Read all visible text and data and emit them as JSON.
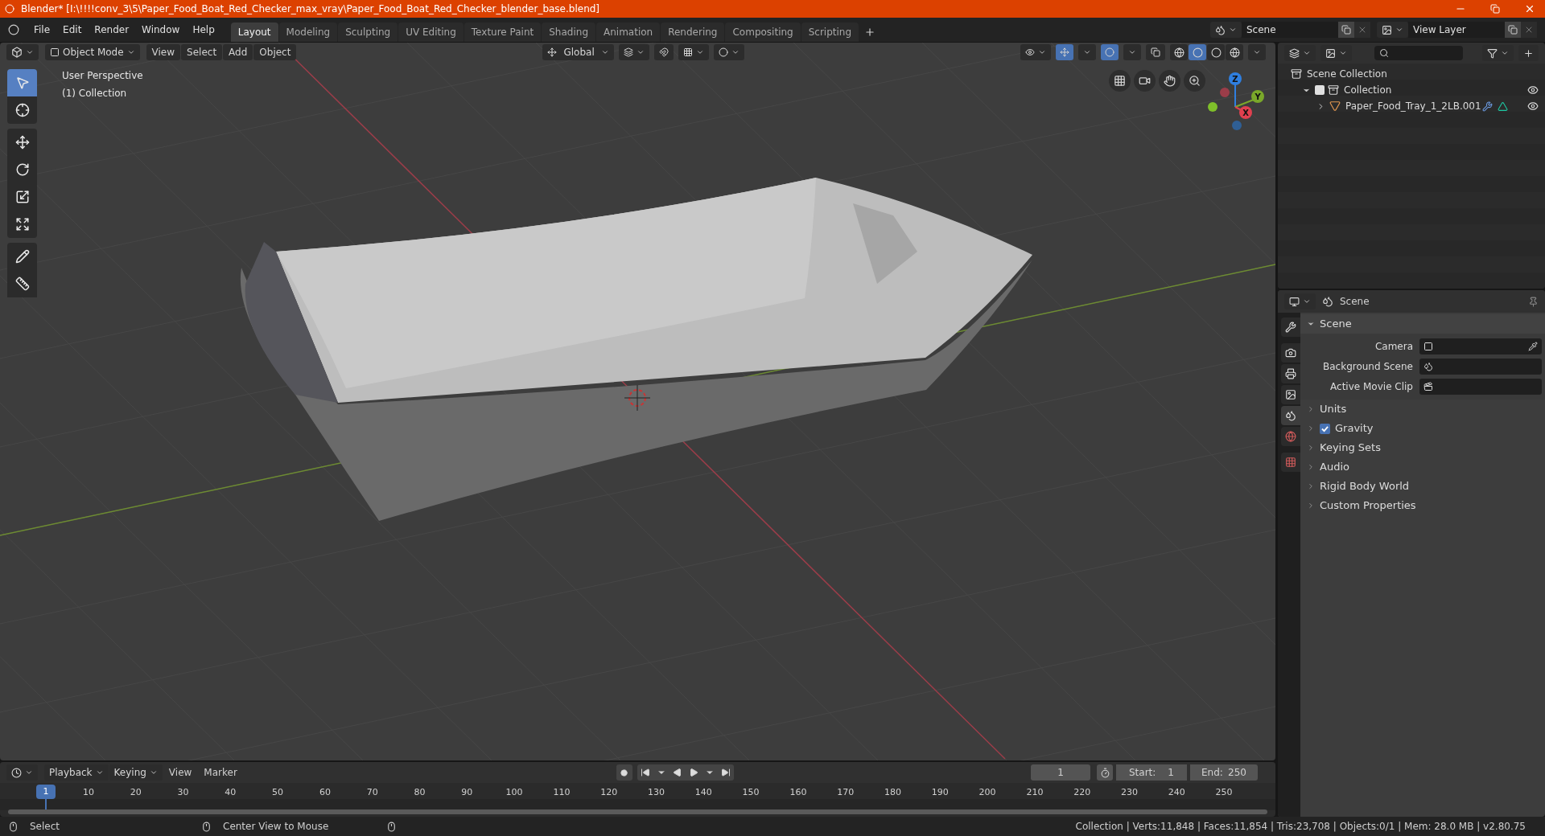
{
  "title_bar": {
    "title": "Blender* [I:\\!!!!conv_3\\5\\Paper_Food_Boat_Red_Checker_max_vray\\Paper_Food_Boat_Red_Checker_blender_base.blend]"
  },
  "menu": [
    "File",
    "Edit",
    "Render",
    "Window",
    "Help"
  ],
  "workspaces": [
    {
      "label": "Layout",
      "selected": true
    },
    {
      "label": "Modeling",
      "selected": false
    },
    {
      "label": "Sculpting",
      "selected": false
    },
    {
      "label": "UV Editing",
      "selected": false
    },
    {
      "label": "Texture Paint",
      "selected": false
    },
    {
      "label": "Shading",
      "selected": false
    },
    {
      "label": "Animation",
      "selected": false
    },
    {
      "label": "Rendering",
      "selected": false
    },
    {
      "label": "Compositing",
      "selected": false
    },
    {
      "label": "Scripting",
      "selected": false
    }
  ],
  "scene": {
    "value": "Scene"
  },
  "view_layer": {
    "value": "View Layer"
  },
  "viewport_header": {
    "mode": "Object Mode",
    "menus": [
      "View",
      "Select",
      "Add",
      "Object"
    ],
    "orientation": "Global",
    "gizmos_on": true,
    "overlays_on": true,
    "shading": [
      {
        "kind": "wireframe",
        "selected": false
      },
      {
        "kind": "solid",
        "selected": true
      },
      {
        "kind": "material",
        "selected": false
      },
      {
        "kind": "rendered",
        "selected": false
      }
    ]
  },
  "viewport": {
    "view_name": "User Perspective",
    "collection_label": "(1) Collection",
    "axes": [
      {
        "label": "Z",
        "color": "#2f7fe0"
      },
      {
        "label": "Y",
        "color": "#7aa82a"
      },
      {
        "label": "X",
        "color": "#e0404f"
      }
    ]
  },
  "tools": [
    {
      "kind": "select",
      "selected": true
    },
    {
      "kind": "cursor",
      "selected": false
    },
    {
      "kind": "move",
      "selected": false
    },
    {
      "kind": "rotate",
      "selected": false
    },
    {
      "kind": "scale",
      "selected": false
    },
    {
      "kind": "transform",
      "selected": false
    },
    {
      "kind": "annotate",
      "selected": false
    },
    {
      "kind": "measure",
      "selected": false
    }
  ],
  "outliner": {
    "tree": [
      {
        "label": "Scene Collection",
        "kind": "scene_collection",
        "children": [
          {
            "label": "Collection",
            "kind": "collection",
            "checked": true,
            "expanded": true,
            "visible": true,
            "children": [
              {
                "label": "Paper_Food_Tray_1_2LB.001",
                "kind": "mesh",
                "expanded": false,
                "visible": true
              }
            ]
          }
        ]
      }
    ]
  },
  "properties": {
    "context": "Scene",
    "tabs": [
      {
        "kind": "tool",
        "selected": false
      },
      {
        "kind": "render",
        "selected": false
      },
      {
        "kind": "output",
        "selected": false
      },
      {
        "kind": "view_layer",
        "selected": false
      },
      {
        "kind": "scene",
        "selected": true
      },
      {
        "kind": "world",
        "selected": false
      },
      {
        "kind": "texture",
        "selected": false
      }
    ],
    "section": {
      "label": "Scene",
      "expanded": true,
      "fields": [
        {
          "label": "Camera",
          "kind": "camera"
        },
        {
          "label": "Background Scene",
          "kind": "scene"
        },
        {
          "label": "Active Movie Clip",
          "kind": "clip"
        }
      ]
    },
    "panels": [
      {
        "label": "Units",
        "kind": "plain"
      },
      {
        "label": "Gravity",
        "kind": "checkbox",
        "checked": true
      },
      {
        "label": "Keying Sets",
        "kind": "plain"
      },
      {
        "label": "Audio",
        "kind": "plain"
      },
      {
        "label": "Rigid Body World",
        "kind": "plain"
      },
      {
        "label": "Custom Properties",
        "kind": "plain"
      }
    ]
  },
  "timeline": {
    "menus": [
      {
        "label": "Playback",
        "dropdown": true
      },
      {
        "label": "Keying",
        "dropdown": true
      },
      {
        "label": "View",
        "dropdown": false
      },
      {
        "label": "Marker",
        "dropdown": false
      }
    ],
    "current_frame": "1",
    "start_label": "Start:",
    "start": "1",
    "end_label": "End:",
    "end": "250",
    "playhead": "1",
    "ruler": [
      "10",
      "20",
      "30",
      "40",
      "50",
      "60",
      "70",
      "80",
      "90",
      "100",
      "110",
      "120",
      "130",
      "140",
      "150",
      "160",
      "170",
      "180",
      "190",
      "200",
      "210",
      "220",
      "230",
      "240",
      "250"
    ]
  },
  "status_bar": {
    "hints": [
      {
        "label": "Select"
      },
      {
        "label": "Center View to Mouse"
      }
    ],
    "stats": "Collection | Verts:11,848 | Faces:11,854 | Tris:23,708 | Objects:0/1 | Mem: 28.0 MB | v2.80.75"
  }
}
